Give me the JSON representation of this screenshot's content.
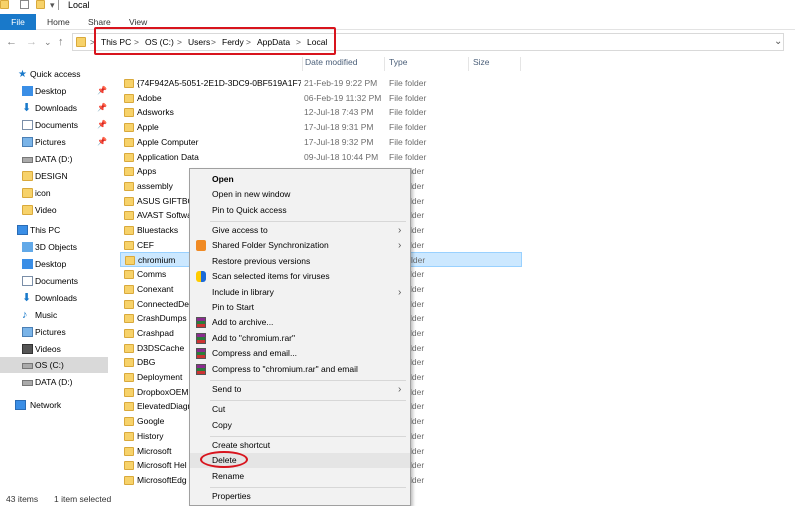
{
  "window": {
    "title": "Local"
  },
  "ribbon": {
    "tabs": [
      "File",
      "Home",
      "Share",
      "View"
    ]
  },
  "address": {
    "crumbs": [
      "This PC",
      "OS (C:)",
      "Users",
      "Ferdy",
      "AppData",
      "Local"
    ],
    "separator": ">"
  },
  "nav_glyphs": {
    "back": "←",
    "forward": "→",
    "recent": "⌄",
    "up": "↑",
    "dropdown": "⌄",
    "menu_arrow": "›"
  },
  "columns": {
    "date": "Date modified",
    "type": "Type",
    "size": "Size"
  },
  "nav_pane": {
    "quick_access": "Quick access",
    "items": [
      {
        "label": "Desktop",
        "pinned": true
      },
      {
        "label": "Downloads",
        "pinned": true
      },
      {
        "label": "Documents",
        "pinned": true
      },
      {
        "label": "Pictures",
        "pinned": true
      },
      {
        "label": "DATA (D:)"
      },
      {
        "label": "DESIGN"
      },
      {
        "label": "icon"
      },
      {
        "label": "Video"
      },
      {
        "label": "This PC"
      },
      {
        "label": "3D Objects"
      },
      {
        "label": "Desktop"
      },
      {
        "label": "Documents"
      },
      {
        "label": "Downloads"
      },
      {
        "label": "Music"
      },
      {
        "label": "Pictures"
      },
      {
        "label": "Videos"
      },
      {
        "label": "OS (C:)"
      },
      {
        "label": "DATA (D:)"
      },
      {
        "label": "Network"
      }
    ],
    "pin_glyph": "📌"
  },
  "files": [
    {
      "name": "{74F942A5-5051-2E1D-3DC9-0BF519A1F7...",
      "date": "21-Feb-19 9:22 PM",
      "type": "File folder"
    },
    {
      "name": "Adobe",
      "date": "06-Feb-19 11:32 PM",
      "type": "File folder"
    },
    {
      "name": "Adsworks",
      "date": "12-Jul-18 7:43 PM",
      "type": "File folder"
    },
    {
      "name": "Apple",
      "date": "17-Jul-18 9:31 PM",
      "type": "File folder"
    },
    {
      "name": "Apple Computer",
      "date": "17-Jul-18 9:32 PM",
      "type": "File folder"
    },
    {
      "name": "Application Data",
      "date": "09-Jul-18 10:44 PM",
      "type": "File folder"
    },
    {
      "name": "Apps",
      "date": "",
      "type": "lder"
    },
    {
      "name": "assembly",
      "date": "",
      "type": "lder"
    },
    {
      "name": "ASUS GIFTBO",
      "date": "",
      "type": "lder"
    },
    {
      "name": "AVAST Softwa",
      "date": "",
      "type": "lder"
    },
    {
      "name": "Bluestacks",
      "date": "",
      "type": "lder"
    },
    {
      "name": "CEF",
      "date": "",
      "type": "lder"
    },
    {
      "name": "chromium",
      "date": "",
      "type": "lder"
    },
    {
      "name": "Comms",
      "date": "",
      "type": "lder"
    },
    {
      "name": "Conexant",
      "date": "",
      "type": "lder"
    },
    {
      "name": "ConnectedDe",
      "date": "",
      "type": "lder"
    },
    {
      "name": "CrashDumps",
      "date": "",
      "type": "lder"
    },
    {
      "name": "Crashpad",
      "date": "",
      "type": "lder"
    },
    {
      "name": "D3DSCache",
      "date": "",
      "type": "lder"
    },
    {
      "name": "DBG",
      "date": "",
      "type": "lder"
    },
    {
      "name": "Deployment",
      "date": "",
      "type": "lder"
    },
    {
      "name": "DropboxOEM",
      "date": "",
      "type": "lder"
    },
    {
      "name": "ElevatedDiagr",
      "date": "",
      "type": "lder"
    },
    {
      "name": "Google",
      "date": "",
      "type": "lder"
    },
    {
      "name": "History",
      "date": "",
      "type": "lder"
    },
    {
      "name": "Microsoft",
      "date": "",
      "type": "lder"
    },
    {
      "name": "Microsoft Hel",
      "date": "",
      "type": "lder"
    },
    {
      "name": "MicrosoftEdg",
      "date": "",
      "type": "lder"
    }
  ],
  "status": {
    "count": "43 items",
    "selected": "1 item selected"
  },
  "context_menu": {
    "items": [
      {
        "label": "Open",
        "bold": true
      },
      {
        "label": "Open in new window"
      },
      {
        "label": "Pin to Quick access"
      },
      {
        "label": "Give access to",
        "submenu": true
      },
      {
        "label": "Shared Folder Synchronization",
        "submenu": true,
        "icon": "sync-icon"
      },
      {
        "label": "Restore previous versions"
      },
      {
        "label": "Scan selected items for viruses",
        "icon": "antivirus-icon"
      },
      {
        "label": "Include in library",
        "submenu": true
      },
      {
        "label": "Pin to Start"
      },
      {
        "label": "Add to archive...",
        "icon": "winrar-icon"
      },
      {
        "label": "Add to \"chromium.rar\"",
        "icon": "winrar-icon"
      },
      {
        "label": "Compress and email...",
        "icon": "winrar-icon"
      },
      {
        "label": "Compress to \"chromium.rar\" and email",
        "icon": "winrar-icon"
      },
      {
        "label": "Send to",
        "submenu": true
      },
      {
        "label": "Cut"
      },
      {
        "label": "Copy"
      },
      {
        "label": "Create shortcut"
      },
      {
        "label": "Delete"
      },
      {
        "label": "Rename"
      },
      {
        "label": "Properties"
      }
    ]
  },
  "colors": {
    "accent": "#1979ca",
    "highlight": "#d8141d",
    "selection": "#cce8ff",
    "folder": "#f7d26a"
  }
}
